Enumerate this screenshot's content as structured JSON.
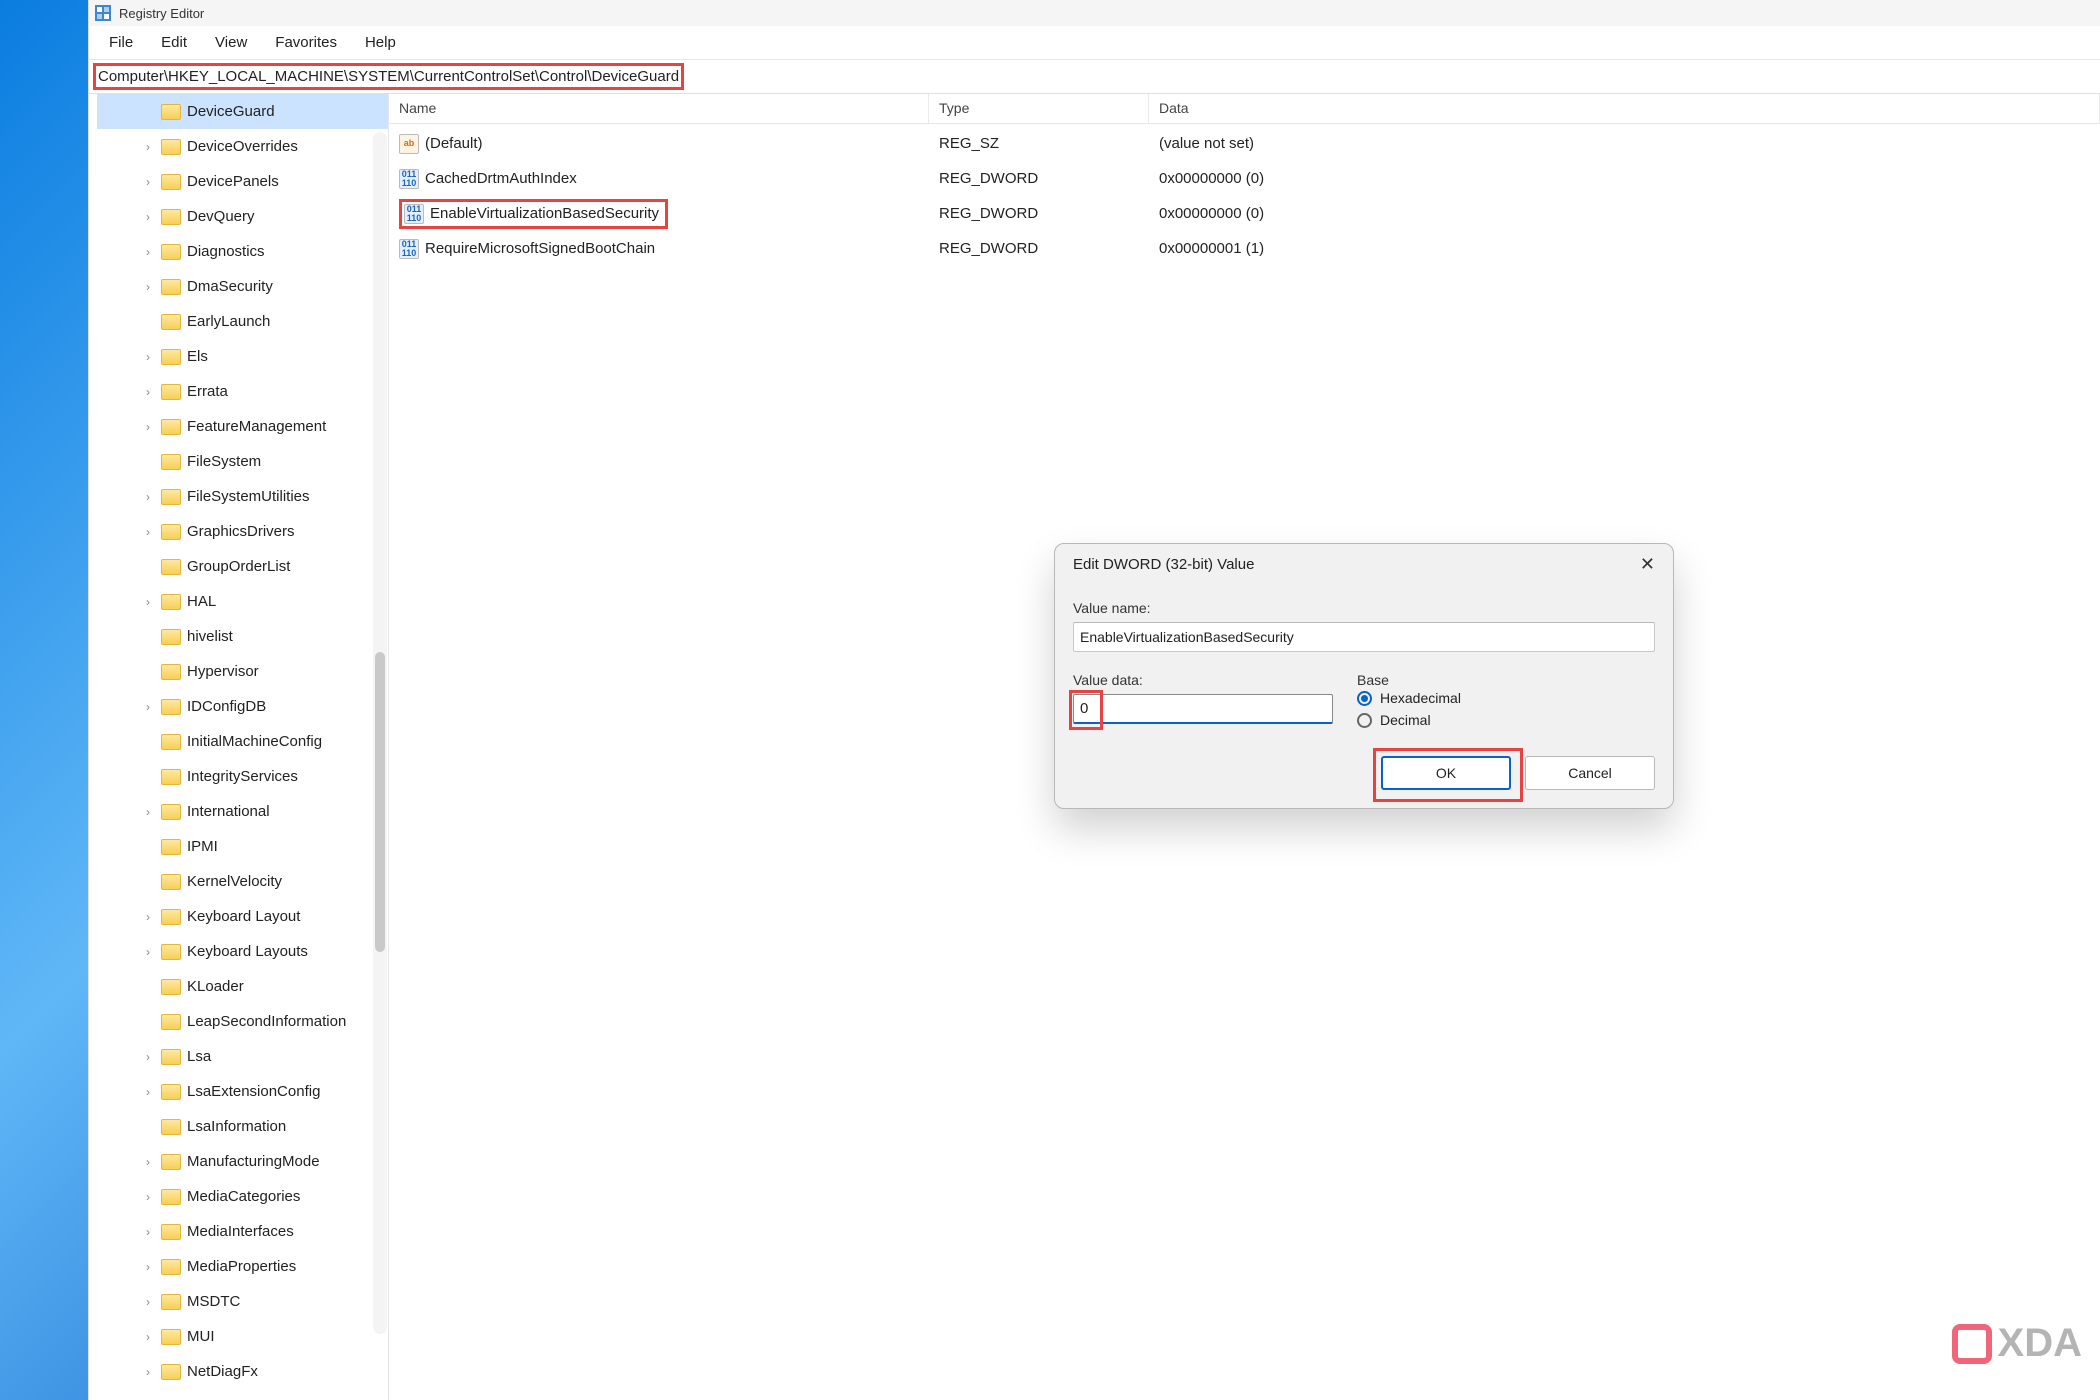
{
  "app": {
    "title": "Registry Editor"
  },
  "menu": {
    "file": "File",
    "edit": "Edit",
    "view": "View",
    "favorites": "Favorites",
    "help": "Help"
  },
  "addressbar": {
    "path": "Computer\\HKEY_LOCAL_MACHINE\\SYSTEM\\CurrentControlSet\\Control\\DeviceGuard"
  },
  "columns": {
    "name": "Name",
    "type": "Type",
    "data": "Data"
  },
  "tree": {
    "items": [
      {
        "label": "DeviceGuard",
        "expandable": false,
        "selected": true
      },
      {
        "label": "DeviceOverrides",
        "expandable": true
      },
      {
        "label": "DevicePanels",
        "expandable": true
      },
      {
        "label": "DevQuery",
        "expandable": true
      },
      {
        "label": "Diagnostics",
        "expandable": true
      },
      {
        "label": "DmaSecurity",
        "expandable": true
      },
      {
        "label": "EarlyLaunch",
        "expandable": false
      },
      {
        "label": "Els",
        "expandable": true
      },
      {
        "label": "Errata",
        "expandable": true
      },
      {
        "label": "FeatureManagement",
        "expandable": true
      },
      {
        "label": "FileSystem",
        "expandable": false
      },
      {
        "label": "FileSystemUtilities",
        "expandable": true
      },
      {
        "label": "GraphicsDrivers",
        "expandable": true
      },
      {
        "label": "GroupOrderList",
        "expandable": false
      },
      {
        "label": "HAL",
        "expandable": true
      },
      {
        "label": "hivelist",
        "expandable": false
      },
      {
        "label": "Hypervisor",
        "expandable": false
      },
      {
        "label": "IDConfigDB",
        "expandable": true
      },
      {
        "label": "InitialMachineConfig",
        "expandable": false
      },
      {
        "label": "IntegrityServices",
        "expandable": false
      },
      {
        "label": "International",
        "expandable": true
      },
      {
        "label": "IPMI",
        "expandable": false
      },
      {
        "label": "KernelVelocity",
        "expandable": false
      },
      {
        "label": "Keyboard Layout",
        "expandable": true
      },
      {
        "label": "Keyboard Layouts",
        "expandable": true
      },
      {
        "label": "KLoader",
        "expandable": false
      },
      {
        "label": "LeapSecondInformation",
        "expandable": false
      },
      {
        "label": "Lsa",
        "expandable": true
      },
      {
        "label": "LsaExtensionConfig",
        "expandable": true
      },
      {
        "label": "LsaInformation",
        "expandable": false
      },
      {
        "label": "ManufacturingMode",
        "expandable": true
      },
      {
        "label": "MediaCategories",
        "expandable": true
      },
      {
        "label": "MediaInterfaces",
        "expandable": true
      },
      {
        "label": "MediaProperties",
        "expandable": true
      },
      {
        "label": "MSDTC",
        "expandable": true
      },
      {
        "label": "MUI",
        "expandable": true
      },
      {
        "label": "NetDiagFx",
        "expandable": true
      }
    ]
  },
  "values": [
    {
      "name": "(Default)",
      "type": "REG_SZ",
      "data": "(value not set)",
      "icon": "str",
      "glyph": "ab"
    },
    {
      "name": "CachedDrtmAuthIndex",
      "type": "REG_DWORD",
      "data": "0x00000000 (0)",
      "icon": "bin",
      "glyph": "011\n110"
    },
    {
      "name": "EnableVirtualizationBasedSecurity",
      "type": "REG_DWORD",
      "data": "0x00000000 (0)",
      "icon": "bin",
      "glyph": "011\n110",
      "highlighted": true
    },
    {
      "name": "RequireMicrosoftSignedBootChain",
      "type": "REG_DWORD",
      "data": "0x00000001 (1)",
      "icon": "bin",
      "glyph": "011\n110"
    }
  ],
  "dialog": {
    "title": "Edit DWORD (32-bit) Value",
    "value_name_label": "Value name:",
    "value_name": "EnableVirtualizationBasedSecurity",
    "value_data_label": "Value data:",
    "value_data": "0",
    "base_label": "Base",
    "hex_label": "Hexadecimal",
    "dec_label": "Decimal",
    "ok": "OK",
    "cancel": "Cancel"
  },
  "watermark": {
    "text": "XDA"
  }
}
